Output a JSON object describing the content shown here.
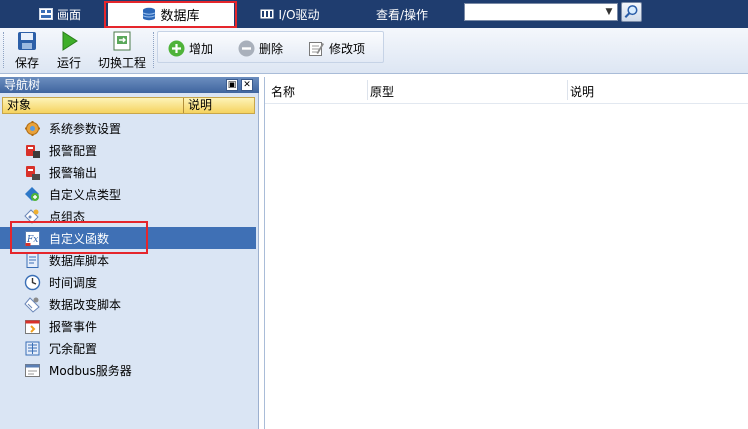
{
  "tabs": [
    {
      "label": "画面",
      "icon": "screen-icon"
    },
    {
      "label": "数据库",
      "icon": "database-icon"
    },
    {
      "label": "I/O驱动",
      "icon": "io-driver-icon"
    },
    {
      "label": "查看/操作",
      "icon": ""
    }
  ],
  "search": {
    "value": "",
    "placeholder": ""
  },
  "toolbar": {
    "save_label": "保存",
    "run_label": "运行",
    "switch_project_label": "切换工程",
    "add_label": "增加",
    "delete_label": "删除",
    "edit_label": "修改项"
  },
  "nav": {
    "title": "导航树",
    "pin_glyph": "▣",
    "close_glyph": "✕",
    "col_object": "对象",
    "col_desc": "说明",
    "items": [
      {
        "label": "系统参数设置",
        "icon": "settings-gear-icon"
      },
      {
        "label": "报警配置",
        "icon": "alarm-config-icon"
      },
      {
        "label": "报警输出",
        "icon": "alarm-output-icon"
      },
      {
        "label": "自定义点类型",
        "icon": "custom-point-type-icon"
      },
      {
        "label": "点组态",
        "icon": "point-config-icon"
      },
      {
        "label": "自定义函数",
        "icon": "function-icon"
      },
      {
        "label": "数据库脚本",
        "icon": "script-icon"
      },
      {
        "label": "时间调度",
        "icon": "clock-icon"
      },
      {
        "label": "数据改变脚本",
        "icon": "data-change-script-icon"
      },
      {
        "label": "报警事件",
        "icon": "alarm-event-icon"
      },
      {
        "label": "冗余配置",
        "icon": "redundancy-icon"
      },
      {
        "label": "Modbus服务器",
        "icon": "modbus-server-icon"
      }
    ]
  },
  "table": {
    "columns": [
      "名称",
      "原型",
      "说明"
    ]
  },
  "colors": {
    "tabbar_bg": "#1f3d6f",
    "selected_row": "#3f70b5",
    "highlight_border": "#e5262c",
    "nav_bg": "#dae5f4"
  }
}
